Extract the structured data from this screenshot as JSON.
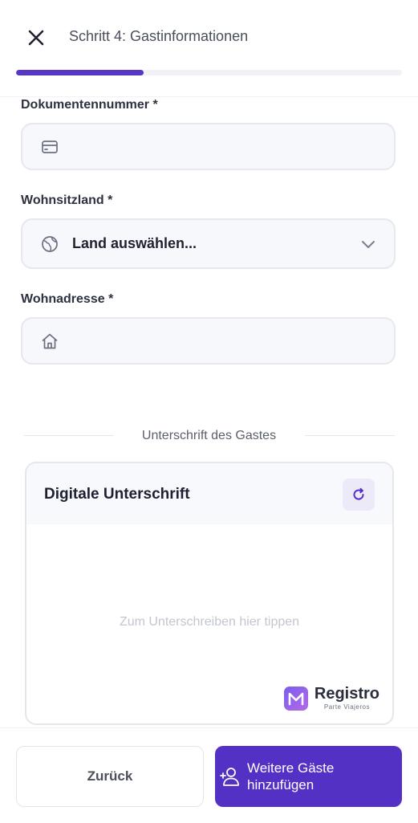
{
  "header": {
    "title": "Schritt 4: Gastinformationen",
    "progress": 0.33
  },
  "form": {
    "document_number": {
      "label": "Dokumentennummer *",
      "value": "",
      "icon": "id-card-icon"
    },
    "country": {
      "label": "Wohnsitzland *",
      "value": "Land auswählen...",
      "icon": "globe-icon"
    },
    "address": {
      "label": "Wohnadresse *",
      "value": "",
      "icon": "home-icon"
    }
  },
  "signature": {
    "divider_label": "Unterschrift des Gastes",
    "title": "Digitale Unterschrift",
    "hint": "Zum Unterschreiben hier tippen",
    "brand_name": "Registro",
    "brand_sub": "Parte Viajeros"
  },
  "footer": {
    "back_label": "Zurück",
    "add_label_line1": "Weitere Gäste",
    "add_label_line2": "hinzufügen"
  },
  "colors": {
    "accent": "#5331c4",
    "progress": "#5736c4",
    "field_bg": "#f7f8fc",
    "field_border": "#e6e8ef"
  }
}
